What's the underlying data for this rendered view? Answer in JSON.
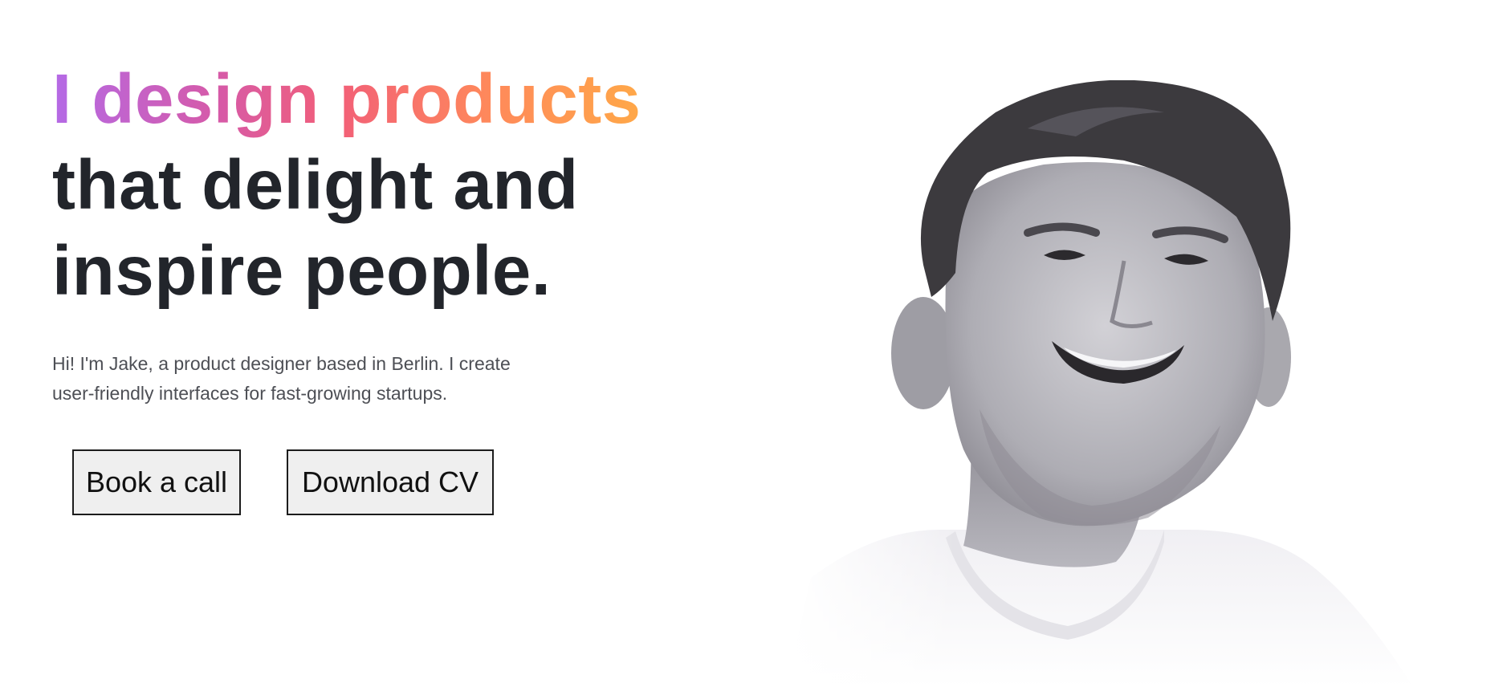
{
  "hero": {
    "headline_gradient": "I design products",
    "headline_line2": "that delight and",
    "headline_line3": "inspire people.",
    "intro_line1": "Hi! I'm Jake, a product designer based in Berlin. I create",
    "intro_line2": "user-friendly interfaces for fast-growing startups."
  },
  "buttons": {
    "book_call": "Book a call",
    "download_cv": "Download CV"
  },
  "portrait": {
    "icon": "portrait-photo"
  },
  "colors": {
    "headline": "#22252b",
    "intro": "#4d4f55",
    "gradient_start": "#b46ae6",
    "gradient_mid": "#f25f78",
    "gradient_end": "#ffa848",
    "button_bg": "#efefef"
  }
}
